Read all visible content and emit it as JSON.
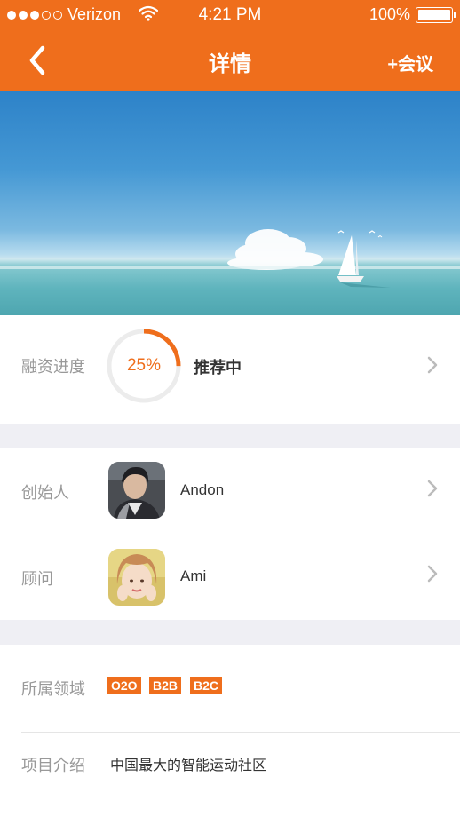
{
  "status_bar": {
    "carrier": "Verizon",
    "time": "4:21 PM",
    "battery": "100%"
  },
  "nav": {
    "title": "详情",
    "action_label": "+会议"
  },
  "financing": {
    "label": "融资进度",
    "progress_text": "25%",
    "progress_value": 0.25,
    "status": "推荐中"
  },
  "founder": {
    "label": "创始人",
    "name": "Andon"
  },
  "advisor": {
    "label": "顾问",
    "name": "Ami"
  },
  "domain": {
    "label": "所属领域",
    "tags": [
      "O2O",
      "B2B",
      "B2C"
    ]
  },
  "intro": {
    "label": "项目介绍",
    "text": "中国最大的智能运动社区"
  },
  "colors": {
    "accent": "#ef6e1c",
    "section_gap": "#efeff4"
  }
}
